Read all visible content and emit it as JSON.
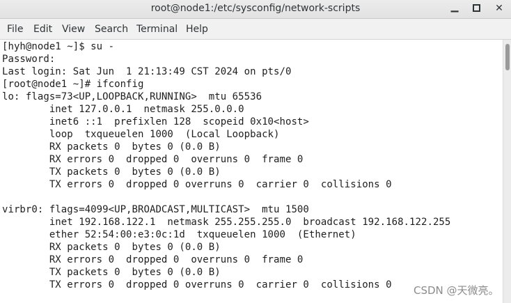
{
  "window": {
    "title": "root@node1:/etc/sysconfig/network-scripts",
    "minimize_glyph": "▁",
    "close_glyph": "✕"
  },
  "menu": {
    "items": [
      "File",
      "Edit",
      "View",
      "Search",
      "Terminal",
      "Help"
    ]
  },
  "terminal": {
    "lines": [
      "[hyh@node1 ~]$ su -",
      "Password:",
      "Last login: Sat Jun  1 21:13:49 CST 2024 on pts/0",
      "[root@node1 ~]# ifconfig",
      "lo: flags=73<UP,LOOPBACK,RUNNING>  mtu 65536",
      "        inet 127.0.0.1  netmask 255.0.0.0",
      "        inet6 ::1  prefixlen 128  scopeid 0x10<host>",
      "        loop  txqueuelen 1000  (Local Loopback)",
      "        RX packets 0  bytes 0 (0.0 B)",
      "        RX errors 0  dropped 0  overruns 0  frame 0",
      "        TX packets 0  bytes 0 (0.0 B)",
      "        TX errors 0  dropped 0 overruns 0  carrier 0  collisions 0",
      "",
      "virbr0: flags=4099<UP,BROADCAST,MULTICAST>  mtu 1500",
      "        inet 192.168.122.1  netmask 255.255.255.0  broadcast 192.168.122.255",
      "        ether 52:54:00:e3:0c:1d  txqueuelen 1000  (Ethernet)",
      "        RX packets 0  bytes 0 (0.0 B)",
      "        RX errors 0  dropped 0  overruns 0  frame 0",
      "        TX packets 0  bytes 0 (0.0 B)",
      "        TX errors 0  dropped 0 overruns 0  carrier 0  collisions 0"
    ]
  },
  "watermark": {
    "text": "CSDN @天微亮。"
  }
}
